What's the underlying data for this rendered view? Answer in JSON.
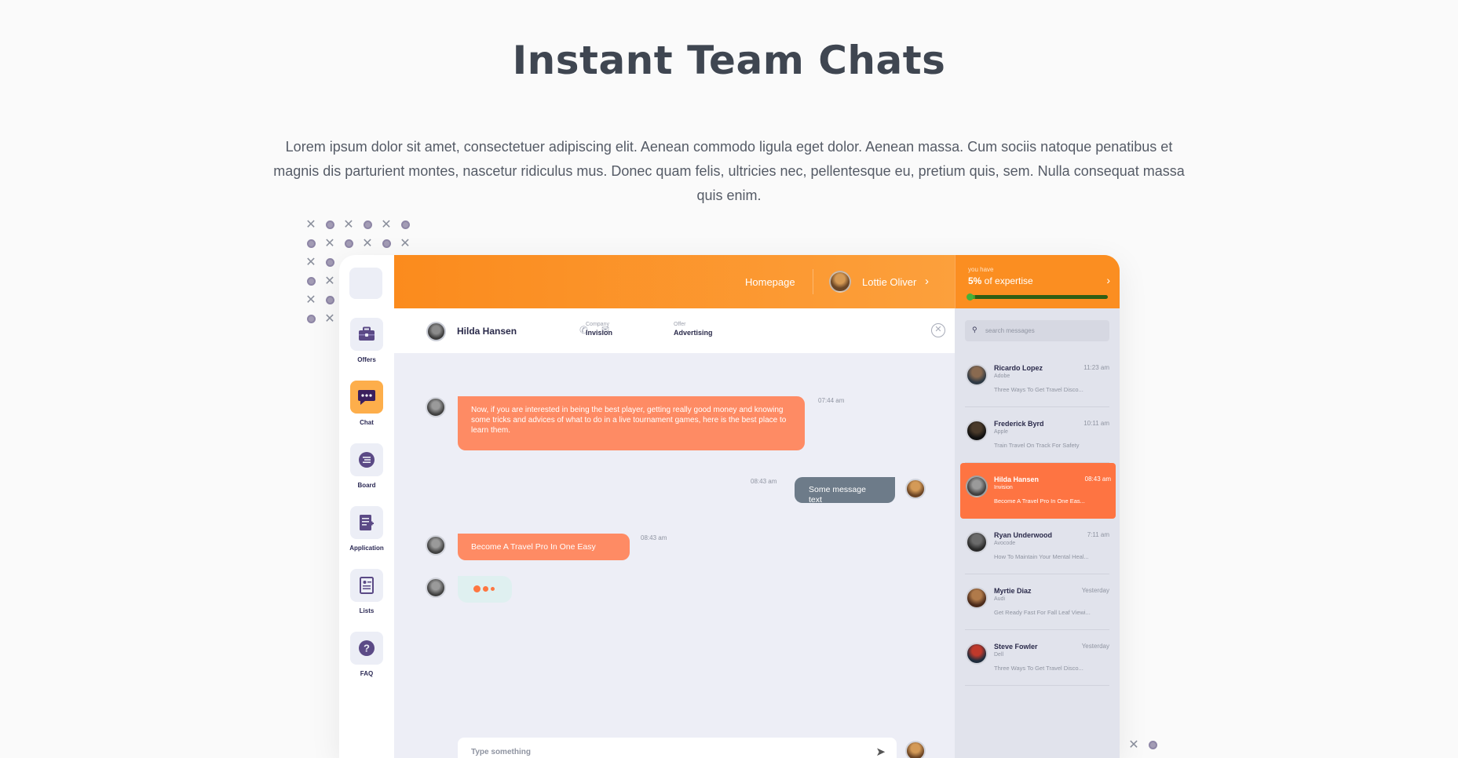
{
  "hero": {
    "title": "Instant Team Chats",
    "description": "Lorem ipsum dolor sit amet, consectetuer adipiscing elit. Aenean commodo ligula eget dolor. Aenean massa. Cum sociis natoque penatibus et magnis dis parturient montes, nascetur ridiculus mus. Donec quam felis, ultricies nec, pellentesque eu, pretium quis, sem. Nulla consequat massa quis enim."
  },
  "colors": {
    "accent": "#fb8b1d",
    "bubble": "#fe8b64",
    "active_conversation": "#fe7442",
    "sidebar_active": "#fdae4b",
    "progress": "#3f9d2a"
  },
  "sidebar": {
    "items": [
      {
        "label": "Offers",
        "icon": "briefcase-icon"
      },
      {
        "label": "Chat",
        "icon": "chat-icon",
        "active": true
      },
      {
        "label": "Board",
        "icon": "list-circle-icon"
      },
      {
        "label": "Application",
        "icon": "document-edit-icon"
      },
      {
        "label": "Lists",
        "icon": "contact-list-icon"
      },
      {
        "label": "FAQ",
        "icon": "question-icon"
      }
    ]
  },
  "topbar": {
    "homepage": "Homepage",
    "user_name": "Lottie Oliver",
    "expertise_small": "you have",
    "expertise_value": "5%",
    "expertise_text": " of expertise",
    "expertise_fraction": 0.05
  },
  "chat": {
    "contact_name": "Hilda Hansen",
    "company_label": "Company",
    "company_value": "Invision",
    "offer_label": "Offer",
    "offer_value": "Advertising",
    "messages": [
      {
        "from": "contact",
        "text": "Now, if you are interested in being the best player, getting really good money and knowing some tricks and advices of what to do in a live tournament games, here is the best place to learn them.",
        "time": "07:44 am"
      },
      {
        "from": "me",
        "text": "Some message text",
        "time": "08:43 am"
      },
      {
        "from": "contact",
        "text": "Become A Travel Pro In One Easy",
        "time": "08:43 am"
      }
    ],
    "composer_placeholder": "Type something"
  },
  "search": {
    "placeholder": "search messages"
  },
  "conversations": [
    {
      "name": "Ricardo Lopez",
      "company": "Adobe",
      "preview": "Three Ways To Get Travel Disco...",
      "time": "11:23 am"
    },
    {
      "name": "Frederick Byrd",
      "company": "Apple",
      "preview": "Train Travel On Track For Safety",
      "time": "10:11 am"
    },
    {
      "name": "Hilda Hansen",
      "company": "Invision",
      "preview": "Become A Travel Pro In One Eas...",
      "time": "08:43 am",
      "active": true
    },
    {
      "name": "Ryan Underwood",
      "company": "Avocode",
      "preview": "How To Maintain Your Mental Heal...",
      "time": "7:11 am"
    },
    {
      "name": "Myrtie Diaz",
      "company": "Audi",
      "preview": "Get Ready Fast For Fall Leaf Viewi...",
      "time": "Yesterday"
    },
    {
      "name": "Steve Fowler",
      "company": "Dell",
      "preview": "Three Ways To Get Travel Disco...",
      "time": "Yesterday"
    }
  ]
}
